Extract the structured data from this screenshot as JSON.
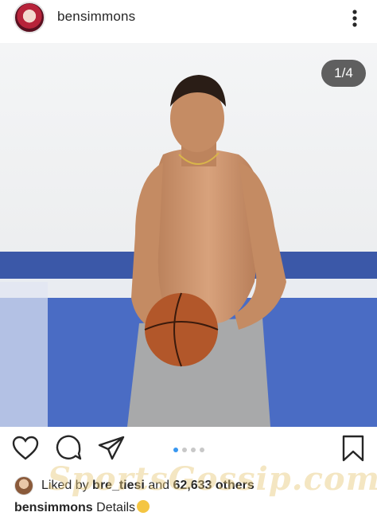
{
  "post": {
    "username": "bensimmons",
    "counter": "1/4",
    "carousel": {
      "count": 4,
      "active_index": 0
    }
  },
  "likes": {
    "prefix": "Liked by",
    "user": "bre_tiesi",
    "joiner": "and",
    "others": "62,633 others"
  },
  "caption": {
    "username": "bensimmons",
    "text": "Details"
  },
  "watermark": {
    "text": "SportsGossip.com"
  },
  "icons": {
    "more": "more-options-icon",
    "like": "heart-icon",
    "comment": "comment-icon",
    "share": "send-icon",
    "save": "bookmark-icon"
  },
  "colors": {
    "dot_active": "#3897f0",
    "dot_inactive": "#c8c8c8",
    "text": "#262626"
  }
}
